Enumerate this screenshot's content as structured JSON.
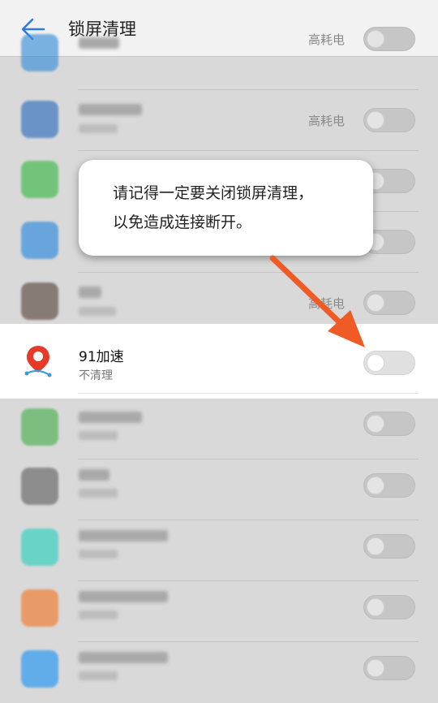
{
  "header": {
    "title": "锁屏清理",
    "back_icon": "arrow-left-icon"
  },
  "list": {
    "high_power_label": "高耗电",
    "rows": [
      {
        "icon_color": "#3a8fd9",
        "shows_high_power": true
      },
      {
        "icon_color": "#2f6fbf",
        "shows_high_power": true
      },
      {
        "icon_color": "#3cba4a",
        "shows_high_power": false
      },
      {
        "icon_color": "#2d8ae0",
        "shows_high_power": false
      },
      {
        "icon_color": "#5a4a40",
        "shows_high_power": true
      },
      {
        "icon_color": "#4caf50",
        "shows_high_power": false
      },
      {
        "icon_color": "#666666",
        "shows_high_power": false
      },
      {
        "icon_color": "#2ed1c0",
        "shows_high_power": false
      },
      {
        "icon_color": "#f07a2a",
        "shows_high_power": false
      },
      {
        "icon_color": "#2196f3",
        "shows_high_power": false
      }
    ]
  },
  "highlighted_app": {
    "name": "91加速",
    "status": "不清理",
    "icon": "location-pin-icon",
    "icon_color": "#e63a2a",
    "toggle_on": false
  },
  "callout": {
    "line1": "请记得一定要关闭锁屏清理，",
    "line2": "以免造成连接断开。"
  },
  "colors": {
    "accent": "#2f7bd9",
    "arrow": "#f05a24"
  }
}
